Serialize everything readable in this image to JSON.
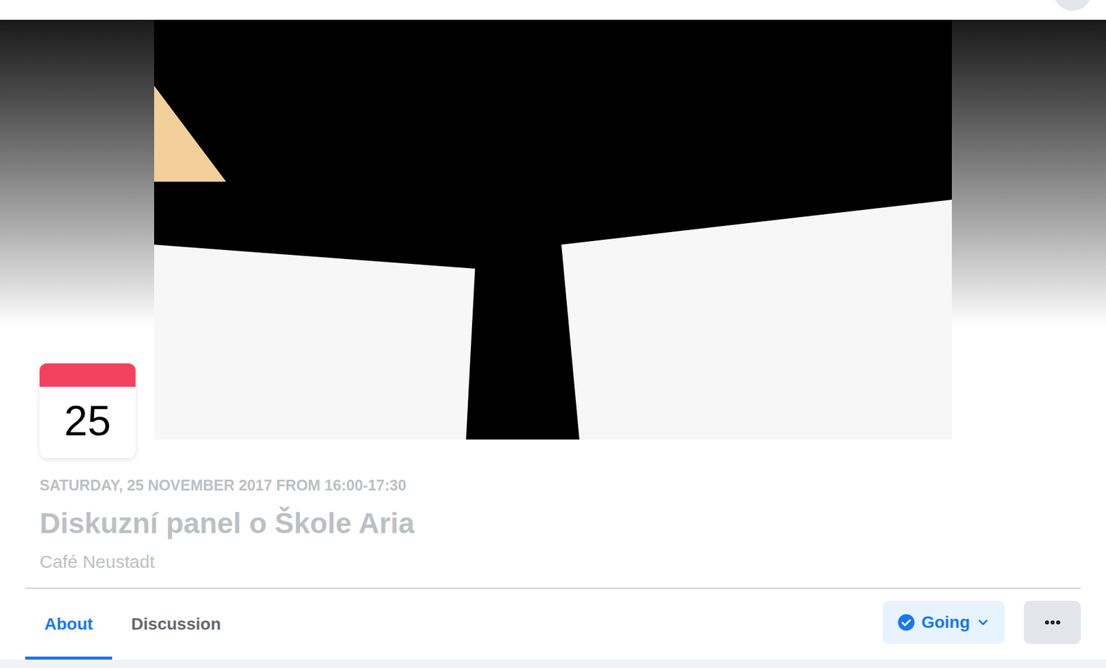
{
  "event": {
    "day": "25",
    "date": "SATURDAY, 25 NOVEMBER 2017 FROM 16:00-17:30",
    "title": "Diskuzní panel o Škole Aria",
    "venue": "Café Neustadt"
  },
  "tabs": [
    {
      "label": "About",
      "selected": true
    },
    {
      "label": "Discussion",
      "selected": false
    }
  ],
  "rsvp": {
    "label": "Going",
    "selected": true
  }
}
